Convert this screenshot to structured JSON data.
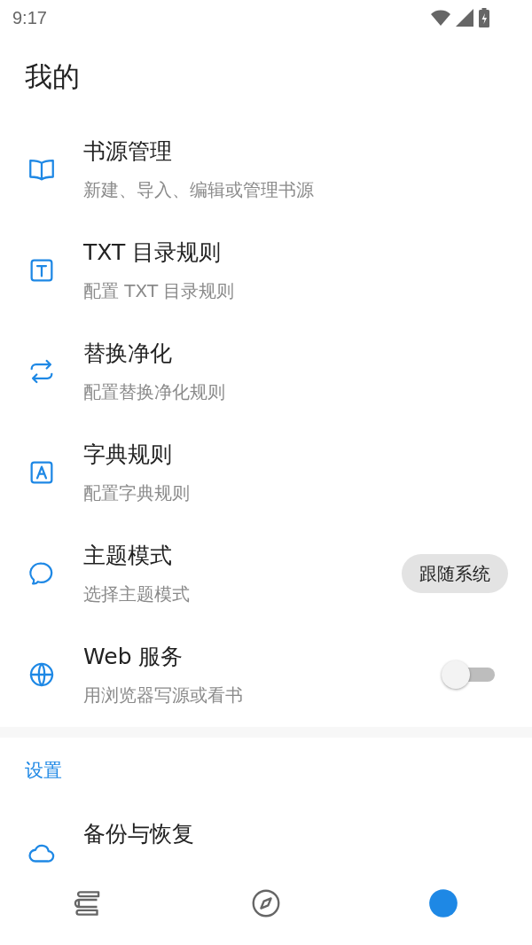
{
  "status_bar": {
    "time": "9:17"
  },
  "title": "我的",
  "items": [
    {
      "title": "书源管理",
      "subtitle": "新建、导入、编辑或管理书源"
    },
    {
      "title": "TXT 目录规则",
      "subtitle": "配置 TXT 目录规则"
    },
    {
      "title": "替换净化",
      "subtitle": "配置替换净化规则"
    },
    {
      "title": "字典规则",
      "subtitle": "配置字典规则"
    },
    {
      "title": "主题模式",
      "subtitle": "选择主题模式",
      "kind": "chip",
      "value": "跟随系统"
    },
    {
      "title": "Web 服务",
      "subtitle": "用浏览器写源或看书",
      "kind": "switch",
      "on": false
    }
  ],
  "section": {
    "title": "设置",
    "items": [
      {
        "title": "备份与恢复"
      }
    ]
  },
  "bottom_nav": [
    {
      "selected": false
    },
    {
      "selected": false
    },
    {
      "selected": true
    }
  ]
}
